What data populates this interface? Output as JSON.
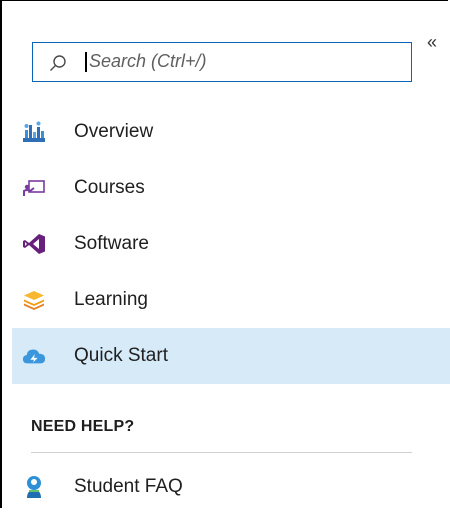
{
  "collapse_glyph": "«",
  "search": {
    "placeholder": "Search (Ctrl+/)",
    "value": ""
  },
  "nav": {
    "items": [
      {
        "label": "Overview",
        "icon": "overview-icon"
      },
      {
        "label": "Courses",
        "icon": "courses-icon"
      },
      {
        "label": "Software",
        "icon": "visual-studio-icon"
      },
      {
        "label": "Learning",
        "icon": "learning-stack-icon"
      },
      {
        "label": "Quick Start",
        "icon": "cloud-icon",
        "active": true
      }
    ]
  },
  "help": {
    "header": "NEED HELP?",
    "items": [
      {
        "label": "Student FAQ",
        "icon": "student-icon"
      }
    ]
  },
  "colors": {
    "active_bg": "#d6eaf8",
    "search_border": "#0a64b8",
    "software_purple": "#68217a",
    "learning_orange": "#f5a623",
    "cloud_blue": "#3a96dd"
  }
}
